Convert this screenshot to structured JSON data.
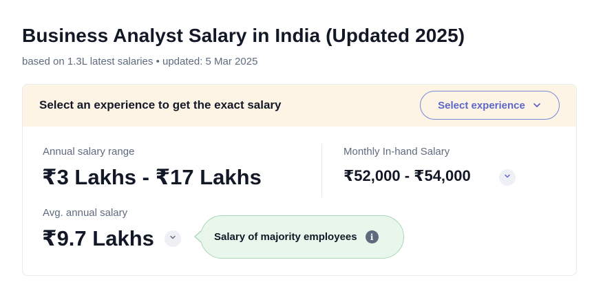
{
  "header": {
    "title": "Business Analyst Salary in India (Updated 2025)",
    "subtitle": "based on 1.3L latest salaries • updated: 5 Mar 2025"
  },
  "banner": {
    "text": "Select an experience to get the exact salary",
    "select_label": "Select experience"
  },
  "annual": {
    "label": "Annual salary range",
    "value": "₹3 Lakhs - ₹17 Lakhs"
  },
  "monthly": {
    "label": "Monthly In-hand Salary",
    "value": "₹52,000 - ₹54,000"
  },
  "avg": {
    "label": "Avg. annual salary",
    "value": "₹9.7 Lakhs"
  },
  "tooltip": {
    "text": "Salary of majority employees",
    "info_glyph": "i"
  },
  "colors": {
    "accent": "#5b66c8",
    "banner_bg": "#fdf4e6",
    "bubble_bg": "#e8f6ec",
    "text_primary": "#121826",
    "text_secondary": "#5e6b7e"
  },
  "icons": {
    "select": "chevron-down-icon",
    "expand": "chevron-down-icon",
    "info": "info-icon"
  }
}
